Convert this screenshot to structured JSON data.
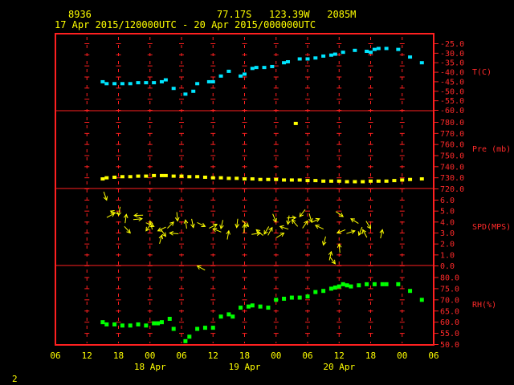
{
  "header": {
    "station": "8936",
    "location": "77.17S   123.39W   2085M",
    "time_range": "17 Apr 2015/120000UTC - 20 Apr 2015/000000UTC"
  },
  "footer": {
    "page_number": "2"
  },
  "x_axis": {
    "tick_labels": [
      "06",
      "12",
      "18",
      "00",
      "06",
      "12",
      "18",
      "00",
      "06",
      "12",
      "18",
      "00",
      "06"
    ],
    "date_labels": [
      {
        "label": "18 Apr",
        "at": "18/00"
      },
      {
        "label": "19 Apr",
        "at": "19/00"
      },
      {
        "label": "20 Apr",
        "at": "20/00"
      }
    ]
  },
  "colors": {
    "frame": "#ff2020",
    "axis_text": "#ff2a2a",
    "header_text": "#ffff00",
    "temperature": "#00e5ff",
    "pressure": "#ffff00",
    "wind": "#ffff00",
    "humidity": "#00ff00"
  },
  "chart_data": [
    {
      "type": "scatter",
      "name": "temperature",
      "panel_label": "T(C)",
      "ylim": [
        -60,
        -25
      ],
      "yticks": [
        "-25.0",
        "-30.0",
        "-35.0",
        "-40.0",
        "-45.0",
        "-50.0",
        "-55.0",
        "-60.0"
      ],
      "unit_x": "hours since 17 Apr 06UTC",
      "x": [
        12,
        13,
        15,
        17,
        19,
        21,
        23,
        25,
        27,
        28,
        30,
        33,
        35,
        36,
        39,
        40,
        42,
        44,
        47,
        48,
        50,
        51,
        53,
        55,
        58,
        59,
        62,
        64,
        66,
        68,
        70,
        71,
        73,
        76,
        79,
        80,
        81,
        82,
        84,
        87,
        90,
        93
      ],
      "values": [
        -45,
        -46,
        -46,
        -46,
        -46,
        -45.5,
        -45.5,
        -45.5,
        -45,
        -44,
        -48.5,
        -51.5,
        -50,
        -46,
        -45,
        -45,
        -42,
        -39.5,
        -42,
        -41,
        -38,
        -37.5,
        -37.5,
        -37,
        -35,
        -34.5,
        -33,
        -33,
        -32.5,
        -31.5,
        -31,
        -30.5,
        -29.5,
        -28.5,
        -29,
        -29.5,
        -28,
        -27.5,
        -27.5,
        -28,
        -32,
        -35
      ]
    },
    {
      "type": "scatter",
      "name": "pressure",
      "panel_label": "Pre (mb)",
      "ylim": [
        720,
        780
      ],
      "yticks": [
        "780.0",
        "770.0",
        "760.0",
        "750.0",
        "740.0",
        "730.0",
        "720.0"
      ],
      "unit_x": "hours since 17 Apr 06UTC",
      "x": [
        12,
        13,
        15,
        17,
        19,
        21,
        23,
        25,
        27,
        28,
        30,
        32,
        34,
        36,
        38,
        40,
        42,
        44,
        46,
        48,
        50,
        52,
        54,
        56,
        58,
        60,
        61,
        62,
        64,
        66,
        68,
        70,
        72,
        74,
        76,
        78,
        80,
        82,
        84,
        86,
        88,
        90,
        93
      ],
      "values": [
        729,
        730,
        730.5,
        731,
        731,
        731.5,
        731.5,
        732,
        732,
        732,
        731.5,
        731.5,
        731,
        731,
        730.5,
        730,
        730,
        729.5,
        729.5,
        729,
        729,
        728.5,
        728.5,
        728.5,
        728,
        728,
        779,
        728,
        727.5,
        727.5,
        727,
        727,
        727,
        726.5,
        726.5,
        726.5,
        727,
        727,
        727,
        727.5,
        728,
        728.5,
        729
      ]
    },
    {
      "type": "scatter",
      "name": "wind speed",
      "panel_label": "SPD(MPS)",
      "ylim": [
        0,
        6.5
      ],
      "yticks": [
        "6.0",
        "5.0",
        "4.0",
        "3.0",
        "2.0",
        "1.0",
        "0.0"
      ],
      "unit_x": "hours since 17 Apr 06UTC",
      "x": [
        13,
        14,
        15,
        16,
        18,
        19,
        20,
        22,
        23,
        24,
        25,
        26,
        27,
        28,
        29,
        30,
        31,
        33,
        35,
        36,
        38,
        40,
        41,
        42,
        44,
        46,
        48,
        49,
        51,
        52,
        53,
        55,
        56,
        57,
        58,
        59,
        60,
        61,
        62,
        64,
        65,
        66,
        67,
        68,
        70,
        71,
        71.5,
        72,
        73,
        75,
        76,
        77,
        78,
        80,
        83
      ],
      "values": [
        6,
        5,
        4.8,
        4.6,
        4.7,
        3,
        4.6,
        4.3,
        3.2,
        4.1,
        3.6,
        3.2,
        2.8,
        2.7,
        3,
        4,
        4.1,
        4.2,
        3.5,
        0,
        3.6,
        3.4,
        3.8,
        3.4,
        3.2,
        3.5,
        3.8,
        3.6,
        3.3,
        3,
        2.9,
        3.5,
        4,
        3.6,
        3,
        3.8,
        4.2,
        4.4,
        4.5,
        4.1,
        4,
        3.7,
        4.3,
        1.9,
        1.3,
        0.2,
        3,
        2,
        4.5,
        4.3,
        3.2,
        2.8,
        3.3,
        3.4,
        3.3
      ]
    },
    {
      "type": "scatter",
      "name": "relative humidity",
      "panel_label": "RH(%)",
      "ylim": [
        50,
        83
      ],
      "yticks": [
        "80.0",
        "75.0",
        "70.0",
        "65.0",
        "60.0",
        "55.0",
        "50.0"
      ],
      "unit_x": "hours since 17 Apr 06UTC",
      "x": [
        12,
        13,
        15,
        17,
        19,
        21,
        23,
        25,
        26,
        27,
        29,
        30,
        33,
        34,
        36,
        38,
        40,
        42,
        44,
        45,
        47,
        49,
        50,
        52,
        54,
        56,
        58,
        60,
        62,
        64,
        66,
        68,
        70,
        71,
        72,
        73,
        74,
        75,
        77,
        79,
        81,
        83,
        84,
        87,
        90,
        93
      ],
      "values": [
        60,
        59,
        59,
        58.5,
        58.5,
        59,
        58.5,
        59.5,
        59.5,
        60,
        61.5,
        57,
        51.5,
        53.5,
        57,
        57.5,
        57.5,
        62.5,
        63.5,
        62.5,
        66.5,
        67,
        67.5,
        67,
        66.5,
        70,
        70.5,
        71,
        71,
        71.5,
        73.5,
        74,
        75,
        75.5,
        76,
        77,
        76.5,
        76,
        76.5,
        77,
        77,
        77,
        77,
        77,
        74,
        70
      ]
    }
  ]
}
